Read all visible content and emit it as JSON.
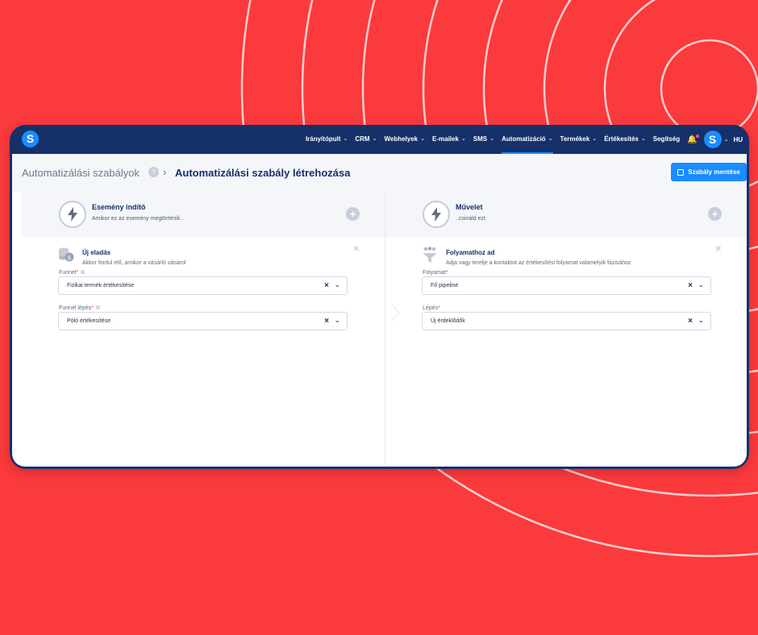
{
  "nav": {
    "items": [
      {
        "label": "Irányítópult",
        "active": false
      },
      {
        "label": "CRM",
        "active": false
      },
      {
        "label": "Webhelyek",
        "active": false
      },
      {
        "label": "E-mailek",
        "active": false
      },
      {
        "label": "SMS",
        "active": false
      },
      {
        "label": "Automatizáció",
        "active": true
      },
      {
        "label": "Termékek",
        "active": false
      },
      {
        "label": "Értékesítés",
        "active": false
      }
    ],
    "help": "Segítség",
    "lang": "HU",
    "avatar_letter": "S",
    "logo_letter": "S"
  },
  "header": {
    "breadcrumb_root": "Automatizálási szabályok",
    "breadcrumb_current": "Automatizálási szabály létrehozása",
    "save_label": "Szabály mentése"
  },
  "left": {
    "section_title": "Esemény indító",
    "section_subtitle": "Amikor ez az esemény megtörténik..",
    "item_title": "Új eladás",
    "item_subtitle": "Akkor fordul elő, amikor a vásárló vásárol",
    "fields": [
      {
        "label": "Funnel",
        "value": "Fizikai termék értékesítése"
      },
      {
        "label": "Funnel lépés",
        "value": "Póló értékesítése"
      }
    ]
  },
  "right": {
    "section_title": "Művelet",
    "section_subtitle": "..csináld ezt",
    "item_title": "Folyamathoz ad",
    "item_subtitle": "Adja vagy terelje a kontaktot az értékesítési folyamat valamelyik fázisához",
    "fields": [
      {
        "label": "Folyamat",
        "value": "Fő pipeline"
      },
      {
        "label": "Lépés",
        "value": "Új érdeklődők"
      }
    ]
  },
  "colors": {
    "background": "#fb3a3d",
    "navbar": "#16306a",
    "accent": "#1a8cff"
  }
}
